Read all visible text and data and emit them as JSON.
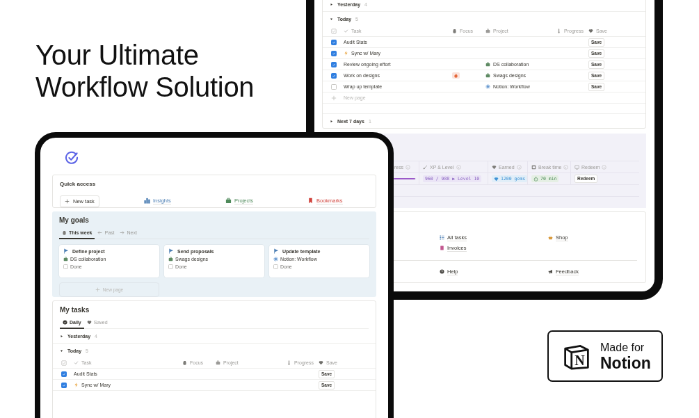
{
  "headline": "Your Ultimate Workflow Solution",
  "back_screen": {
    "task_groups": [
      {
        "label": "Yesterday",
        "count": "4",
        "expanded": false
      },
      {
        "label": "Today",
        "count": "5",
        "expanded": true,
        "columns": [
          "Task",
          "Focus",
          "Project",
          "Progress",
          "Save"
        ],
        "new_page": "New page",
        "rows": [
          {
            "name": "Audit Stats",
            "checked": true,
            "kind": "plain",
            "focus": false,
            "save": "Save"
          },
          {
            "name": "Sync w/ Mary",
            "checked": true,
            "kind": "bolt",
            "focus": false,
            "save": "Save"
          },
          {
            "name": "Review ongoing effort",
            "checked": true,
            "kind": "plain",
            "focus": false,
            "project": {
              "label": "DS collaboration",
              "kind": "briefcase"
            },
            "save": "Save"
          },
          {
            "name": "Work on designs",
            "checked": true,
            "kind": "plain",
            "focus": true,
            "project": {
              "label": "Swags designs",
              "kind": "briefcase"
            },
            "save": "Save"
          },
          {
            "name": "Wrap up template",
            "checked": false,
            "kind": "plain",
            "focus": false,
            "project": {
              "label": "Notion: Workflow",
              "kind": "gear"
            },
            "save": "Save"
          }
        ]
      },
      {
        "label": "Next 7 days",
        "count": "1",
        "expanded": false
      }
    ],
    "stats": {
      "progress": {
        "level": 0.97
      },
      "columns": [
        "ress",
        "XP & Level",
        "Earned",
        "Break time",
        "Redeem"
      ],
      "xp": "960 / 988 ▶ Level 10",
      "earned": "1200 gems",
      "break_time": "70 min",
      "redeem": "Redeem"
    },
    "link_columns": [
      [
        "All tasks",
        "Invoices"
      ],
      [
        "Shop"
      ]
    ],
    "footer_links": [
      "Help",
      "Feedback"
    ]
  },
  "front_screen": {
    "quick_access": {
      "title": "Quick access",
      "new_task": "New task",
      "links": [
        {
          "label": "Insights",
          "color": "#4a7db3"
        },
        {
          "label": "Projects",
          "color": "#4f8a5b"
        },
        {
          "label": "Bookmarks",
          "color": "#d0423b"
        }
      ]
    },
    "goals": {
      "title": "My goals",
      "tabs": [
        {
          "label": "This week",
          "selected": true
        },
        {
          "label": "Past",
          "selected": false
        },
        {
          "label": "Next",
          "selected": false
        }
      ],
      "cards": [
        {
          "title": "Define project",
          "project": {
            "label": "DS collaboration",
            "kind": "briefcase"
          },
          "done_label": "Done",
          "done": false
        },
        {
          "title": "Send proposals",
          "project": {
            "label": "Swags designs",
            "kind": "briefcase"
          },
          "done_label": "Done",
          "done": false
        },
        {
          "title": "Update template",
          "project": {
            "label": "Notion: Workflow",
            "kind": "gear"
          },
          "done_label": "Done",
          "done": false
        }
      ],
      "new_page": "New page"
    },
    "tasks": {
      "title": "My tasks",
      "tabs": [
        {
          "label": "Daily",
          "selected": true
        },
        {
          "label": "Saved",
          "selected": false
        }
      ],
      "task_groups": [
        {
          "label": "Yesterday",
          "count": "4",
          "expanded": false
        },
        {
          "label": "Today",
          "count": "5",
          "expanded": true,
          "columns": [
            "Task",
            "Focus",
            "Project",
            "Progress",
            "Save"
          ],
          "rows": [
            {
              "name": "Audit Stats",
              "checked": true,
              "kind": "plain",
              "focus": false,
              "save": "Save"
            },
            {
              "name": "Sync w/ Mary",
              "checked": true,
              "kind": "bolt",
              "focus": false,
              "save": "Save"
            }
          ]
        }
      ]
    }
  },
  "badge": {
    "logo_letter": "N",
    "line1": "Made for",
    "line2": "Notion"
  }
}
